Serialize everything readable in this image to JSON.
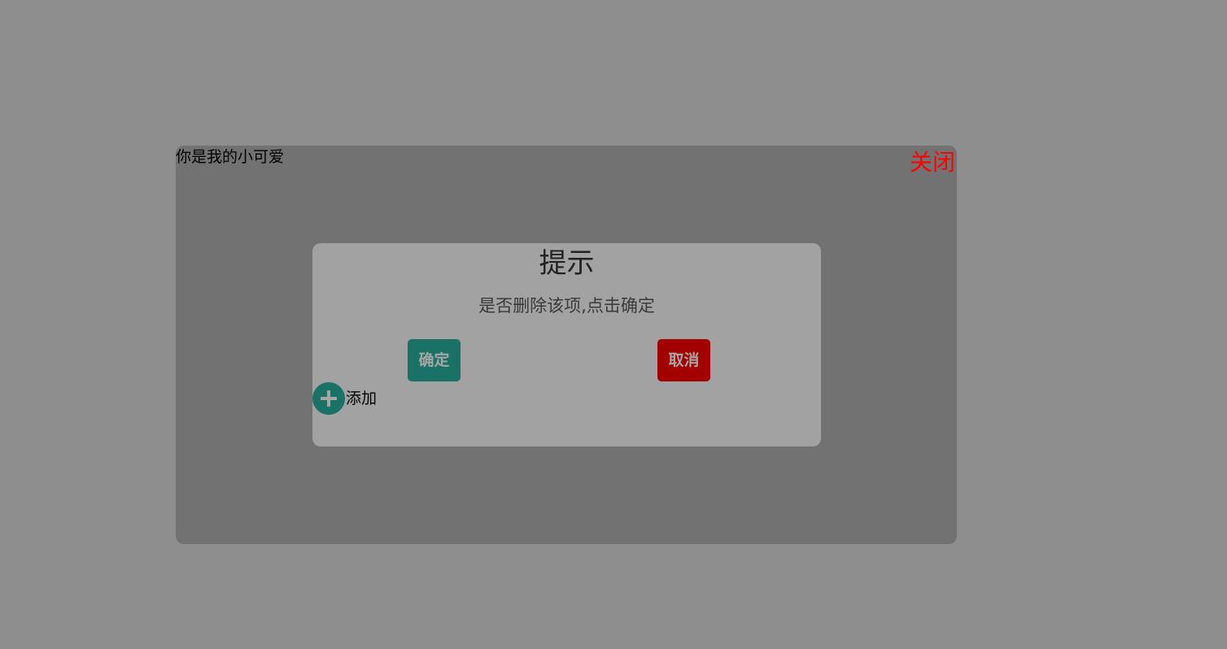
{
  "panel": {
    "title": "你是我的小可爱",
    "close_label": "关闭"
  },
  "dialog": {
    "title": "提示",
    "message": "是否删除该项,点击确定",
    "confirm_label": "确定",
    "cancel_label": "取消"
  },
  "add_action": {
    "label": "添加",
    "icon": "plus-icon"
  },
  "colors": {
    "page_background": "#8e8e8e",
    "panel_background": "#727272",
    "dialog_background": "#a2a2a2",
    "confirm_button": "#1a7166",
    "cancel_button": "#a30000",
    "close_text": "#ff0000"
  }
}
